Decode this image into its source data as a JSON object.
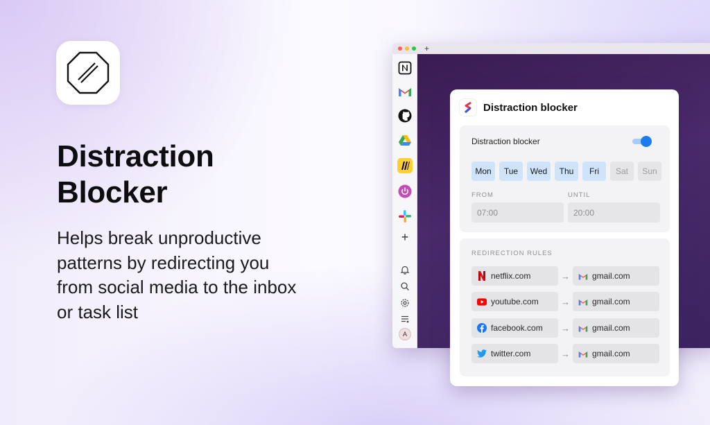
{
  "hero": {
    "headline": "Distraction Blocker",
    "description": "Helps break unproductive patterns by redirecting you from social media to the inbox or task list"
  },
  "browser": {
    "new_tab_label": "+",
    "sidebar_apps": [
      "notion-icon",
      "gmail-icon",
      "github-icon",
      "google-drive-icon",
      "miro-icon",
      "power-icon",
      "slack-icon",
      "add-app-icon"
    ],
    "sidebar_tools": [
      "bell-icon",
      "search-icon",
      "gear-icon",
      "list-icon"
    ],
    "avatar_initial": "A"
  },
  "panel": {
    "title": "Distraction blocker",
    "toggle_label": "Distraction blocker",
    "toggle_on": true,
    "days": [
      {
        "label": "Mon",
        "active": true
      },
      {
        "label": "Tue",
        "active": true
      },
      {
        "label": "Wed",
        "active": true
      },
      {
        "label": "Thu",
        "active": true
      },
      {
        "label": "Fri",
        "active": true
      },
      {
        "label": "Sat",
        "active": false
      },
      {
        "label": "Sun",
        "active": false
      }
    ],
    "from_label": "FROM",
    "until_label": "UNTIL",
    "from_value": "07:00",
    "until_value": "20:00",
    "rules_label": "REDIRECTION RULES",
    "arrow": "→",
    "rules": [
      {
        "source": "netflix.com",
        "source_icon": "netflix-icon",
        "target": "gmail.com",
        "target_icon": "gmail-icon"
      },
      {
        "source": "youtube.com",
        "source_icon": "youtube-icon",
        "target": "gmail.com",
        "target_icon": "gmail-icon"
      },
      {
        "source": "facebook.com",
        "source_icon": "facebook-icon",
        "target": "gmail.com",
        "target_icon": "gmail-icon"
      },
      {
        "source": "twitter.com",
        "source_icon": "twitter-icon",
        "target": "gmail.com",
        "target_icon": "gmail-icon"
      }
    ]
  },
  "colors": {
    "accent": "#1d7bf0",
    "day_active_bg": "#cfe4fb",
    "browser_content": "#3f2160"
  }
}
